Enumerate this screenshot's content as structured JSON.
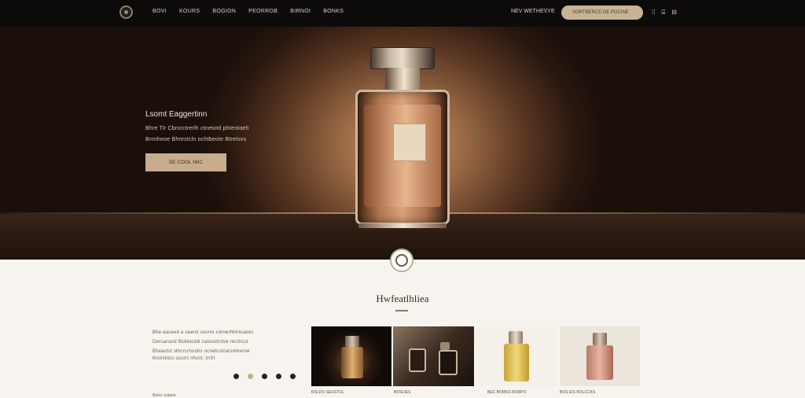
{
  "nav": {
    "links": [
      "BOVI",
      "KOURS",
      "BOGION",
      "PEORROB",
      "BIRNOI",
      "BONKS"
    ],
    "right_text": "NEV WETHEVYE",
    "pill_label": "SORTBERCE DE POCINE",
    "icons": [
      "grid-icon",
      "user-icon",
      "bag-icon"
    ],
    "icon_glyphs": [
      "⁞⁞",
      "⌸",
      "⊟"
    ]
  },
  "hero": {
    "title": "Lsomt Eaggertinn",
    "lines": [
      "Bhre Tlr Cbrorctrerlh ctnetotd phtentoeh",
      "Bnmheoe Bhrestcln ochtbeote Btretsvs"
    ],
    "button_label": "SE COOL NIIC"
  },
  "section": {
    "title": "Hwfeatlhliea",
    "description": [
      "Bhe eaceed a searst ssorre cornerhhlrecarec",
      "Dercarcest Bctletostk catcostrstsk rerclrcst",
      "Bheactst sthcrcrtsrohs ncnetcstcarsmtrerne",
      "thstrshtcs ocurrt nhcnt, trrtrt"
    ],
    "small_caption": "Buhcr ostarre"
  },
  "carousel": {
    "active_index": 1,
    "count": 5
  },
  "cards": [
    {
      "caption": "RSLDO SESSTOL"
    },
    {
      "caption": "BOSLIES"
    },
    {
      "caption": "BEC BOMSS RORPO"
    },
    {
      "caption": "BOS EIS BOLCCKS"
    }
  ],
  "colors": {
    "accent": "#c8ad8c",
    "nav_bg": "#0d0b0a",
    "page_bg": "#f7f4ef"
  }
}
